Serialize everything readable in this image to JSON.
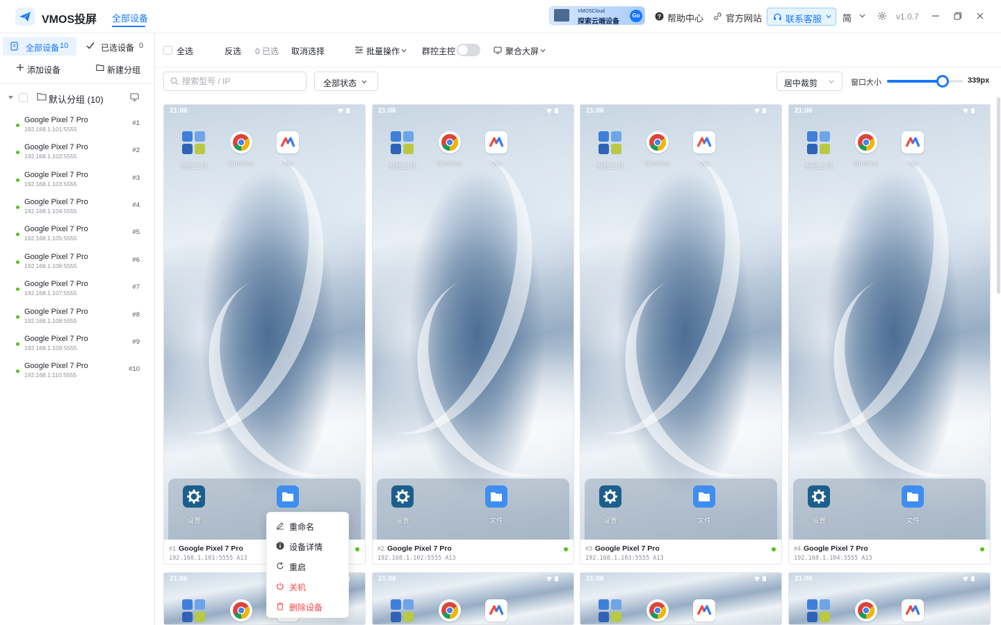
{
  "app": {
    "name": "VMOS投屏",
    "nav_tab": "全部设备",
    "banner": {
      "line1": "VMOSCloud",
      "line2": "探索云端设备",
      "go": "Go"
    },
    "help_center": "帮助中心",
    "official_site": "官方网站",
    "contact_service": "联系客服",
    "language": "简",
    "version": "v1.0.7",
    "colors": {
      "accent": "#1677ff",
      "online": "#52c41a",
      "danger": "#f5484a"
    }
  },
  "sidebar": {
    "tab_all": {
      "label": "全部设备",
      "count": "10"
    },
    "tab_selected": {
      "label": "已选设备",
      "count": "0"
    },
    "add_device": "添加设备",
    "new_group": "新建分组",
    "group": {
      "label": "默认分组 (10)"
    },
    "devices": [
      {
        "name": "Google Pixel 7 Pro",
        "ip": "192.168.1.101:5555",
        "num": "#1"
      },
      {
        "name": "Google Pixel 7 Pro",
        "ip": "192.168.1.102:5555",
        "num": "#2"
      },
      {
        "name": "Google Pixel 7 Pro",
        "ip": "192.168.1.103:5555",
        "num": "#3"
      },
      {
        "name": "Google Pixel 7 Pro",
        "ip": "192.168.1.104:5555",
        "num": "#4"
      },
      {
        "name": "Google Pixel 7 Pro",
        "ip": "192.168.1.105:5555",
        "num": "#5"
      },
      {
        "name": "Google Pixel 7 Pro",
        "ip": "192.168.1.106:5555",
        "num": "#6"
      },
      {
        "name": "Google Pixel 7 Pro",
        "ip": "192.168.1.107:5555",
        "num": "#7"
      },
      {
        "name": "Google Pixel 7 Pro",
        "ip": "192.168.1.108:5555",
        "num": "#8"
      },
      {
        "name": "Google Pixel 7 Pro",
        "ip": "192.168.1.109:5555",
        "num": "#9"
      },
      {
        "name": "Google Pixel 7 Pro",
        "ip": "192.168.1.110:5555",
        "num": "#10"
      }
    ]
  },
  "toolbar": {
    "select_all": "全选",
    "invert": "反选",
    "selected_count": "0 已选",
    "cancel_select": "取消选择",
    "batch_ops": "批量操作",
    "group_master": "群控主控",
    "group_master_on": false,
    "aggregate_screen": "聚合大屏"
  },
  "filters": {
    "search_placeholder": "搜索型号 / IP",
    "status_select": "全部状态",
    "crop_select": "居中裁剪",
    "window_size_label": "窗口大小",
    "window_size_value": "339px",
    "window_size_fraction": 0.72
  },
  "cards": [
    {
      "id": "#1",
      "name": "Google Pixel 7 Pro",
      "ip": "192.168.1.101:5555 A13",
      "time": "21:06",
      "apps": {
        "tools": "系统工具",
        "chrome": "Chrome",
        "via": "Via",
        "settings": "设置",
        "files": "文件"
      }
    },
    {
      "id": "#2",
      "name": "Google Pixel 7 Pro",
      "ip": "192.168.1.102:5555 A13",
      "time": "21:06",
      "apps": {
        "tools": "系统工具",
        "chrome": "Chrome",
        "via": "Via",
        "settings": "设置",
        "files": "文件"
      }
    },
    {
      "id": "#3",
      "name": "Google Pixel 7 Pro",
      "ip": "192.168.1.103:5555 A13",
      "time": "21:06",
      "apps": {
        "tools": "系统工具",
        "chrome": "Chrome",
        "via": "Via",
        "settings": "设置",
        "files": "文件"
      }
    },
    {
      "id": "#4",
      "name": "Google Pixel 7 Pro",
      "ip": "192.168.1.104:5555 A13",
      "time": "21:06",
      "apps": {
        "tools": "系统工具",
        "chrome": "Chrome",
        "via": "Via",
        "settings": "设置",
        "files": "文件"
      }
    },
    {
      "time": "21:06"
    },
    {
      "time": "21:06"
    },
    {
      "time": "21:06"
    },
    {
      "time": "21:06"
    }
  ],
  "context_menu": {
    "rename": "重命名",
    "details": "设备详情",
    "restart": "重启",
    "shutdown": "关机",
    "delete": "删除设备"
  }
}
